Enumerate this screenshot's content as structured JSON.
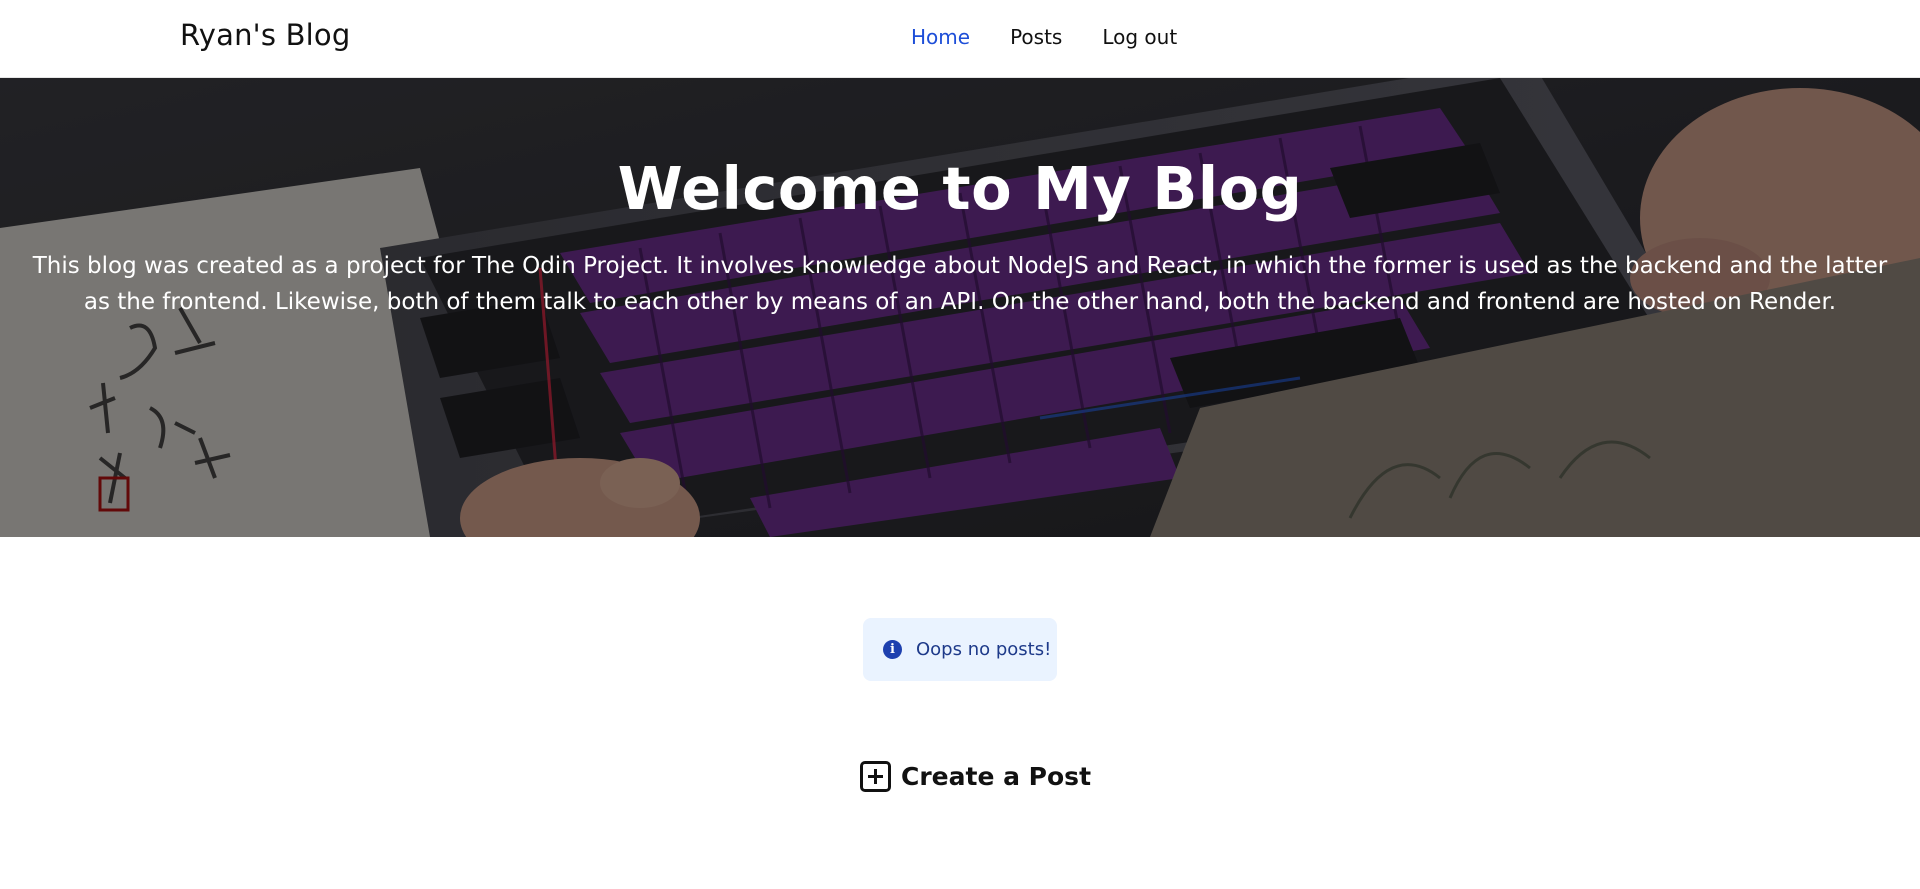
{
  "header": {
    "brand": "Ryan's Blog",
    "nav": [
      {
        "label": "Home",
        "active": true
      },
      {
        "label": "Posts",
        "active": false
      },
      {
        "label": "Log out",
        "active": false
      }
    ],
    "active_color": "#1d4ed8"
  },
  "hero": {
    "title": "Welcome to My Blog",
    "text": "This blog was created as a project for The Odin Project. It involves knowledge about NodeJS and React, in which the former is used as the backend and the latter as the frontend. Likewise, both of them talk to each other by means of an API. On the other hand, both the backend and frontend are hosted on Render.",
    "background_image": "keyboard-photo"
  },
  "alert": {
    "icon": "info-icon",
    "message": "Oops no posts!"
  },
  "create_post": {
    "icon": "plus-square-icon",
    "label": "Create a Post"
  }
}
